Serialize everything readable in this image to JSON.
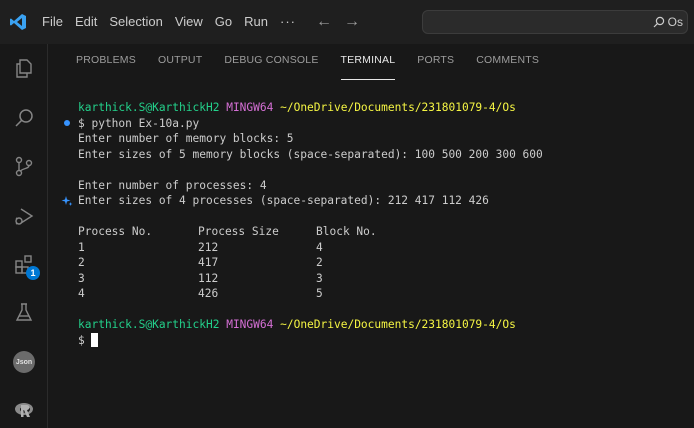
{
  "menu": [
    "File",
    "Edit",
    "Selection",
    "View",
    "Go",
    "Run",
    "···"
  ],
  "nav": {
    "back": "←",
    "forward": "→"
  },
  "command_center": {
    "search_text": "Os"
  },
  "activity": {
    "extensions_badge": "1",
    "json_icon_text": "Json"
  },
  "panel_tabs": [
    "PROBLEMS",
    "OUTPUT",
    "DEBUG CONSOLE",
    "TERMINAL",
    "PORTS",
    "COMMENTS"
  ],
  "active_tab": "TERMINAL",
  "terminal": {
    "prompt1": {
      "user": "karthick.S@KarthickH2",
      "env": "MINGW64",
      "path": "~/OneDrive/Documents/231801079-4/Os"
    },
    "command": "$ python Ex-10a.py",
    "out1": "Enter number of memory blocks: 5",
    "out2": "Enter sizes of 5 memory blocks (space-separated): 100 500 200 300 600",
    "out3": "Enter number of processes: 4",
    "out4": "Enter sizes of 4 processes (space-separated): 212 417 112 426",
    "table_headers": [
      "Process No.",
      "Process Size",
      "Block No."
    ],
    "table_rows": [
      [
        "1",
        "212",
        "4"
      ],
      [
        "2",
        "417",
        "2"
      ],
      [
        "3",
        "112",
        "3"
      ],
      [
        "4",
        "426",
        "5"
      ]
    ],
    "prompt2": {
      "user": "karthick.S@KarthickH2",
      "env": "MINGW64",
      "path": "~/OneDrive/Documents/231801079-4/Os"
    },
    "final_prompt": "$ "
  },
  "colors": {
    "prompt_user": "#23d18b",
    "prompt_env": "#d670d6",
    "prompt_path": "#f5f543",
    "accent": "#0078d4"
  }
}
